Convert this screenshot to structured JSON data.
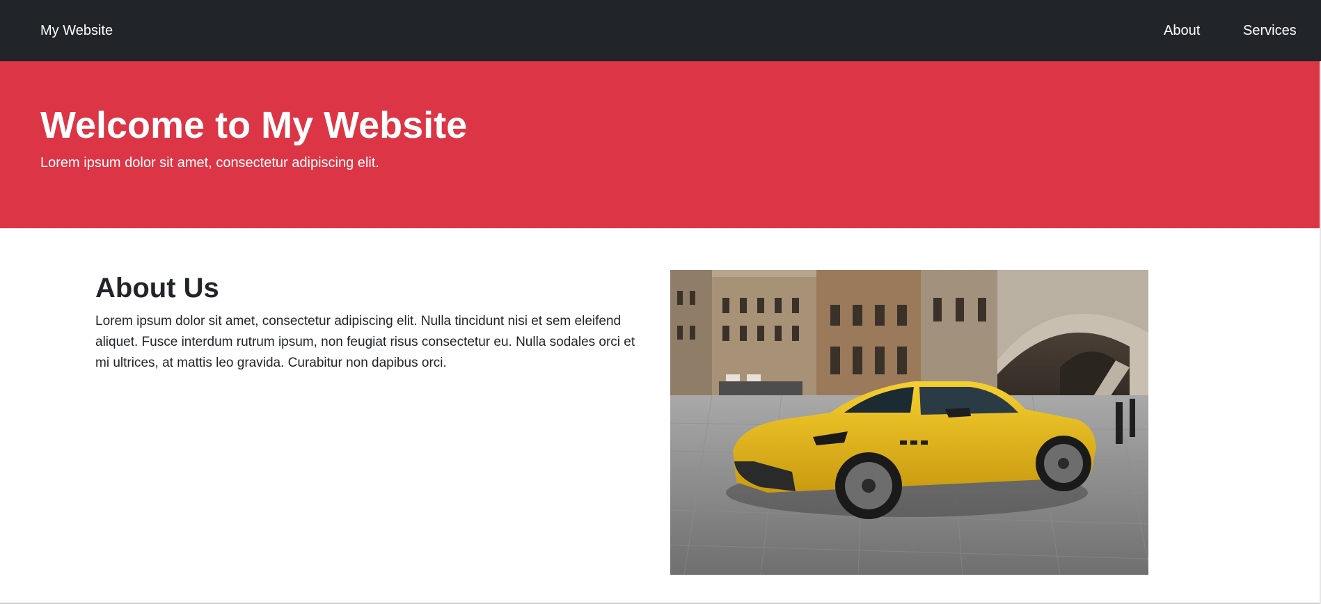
{
  "navbar": {
    "brand": "My Website",
    "links": [
      {
        "label": "About"
      },
      {
        "label": "Services"
      }
    ],
    "bg_color": "#212529"
  },
  "hero": {
    "title": "Welcome to My Website",
    "subtitle": "Lorem ipsum dolor sit amet, consectetur adipiscing elit.",
    "bg_color": "#dc3545"
  },
  "about": {
    "title": "About Us",
    "body": "Lorem ipsum dolor sit amet, consectetur adipiscing elit. Nulla tincidunt nisi et sem eleifend aliquet. Fusce interdum rutrum ipsum, non feugiat risus consectetur eu. Nulla sodales orci et mi ultrices, at mattis leo gravida. Curabitur non dapibus orci."
  }
}
